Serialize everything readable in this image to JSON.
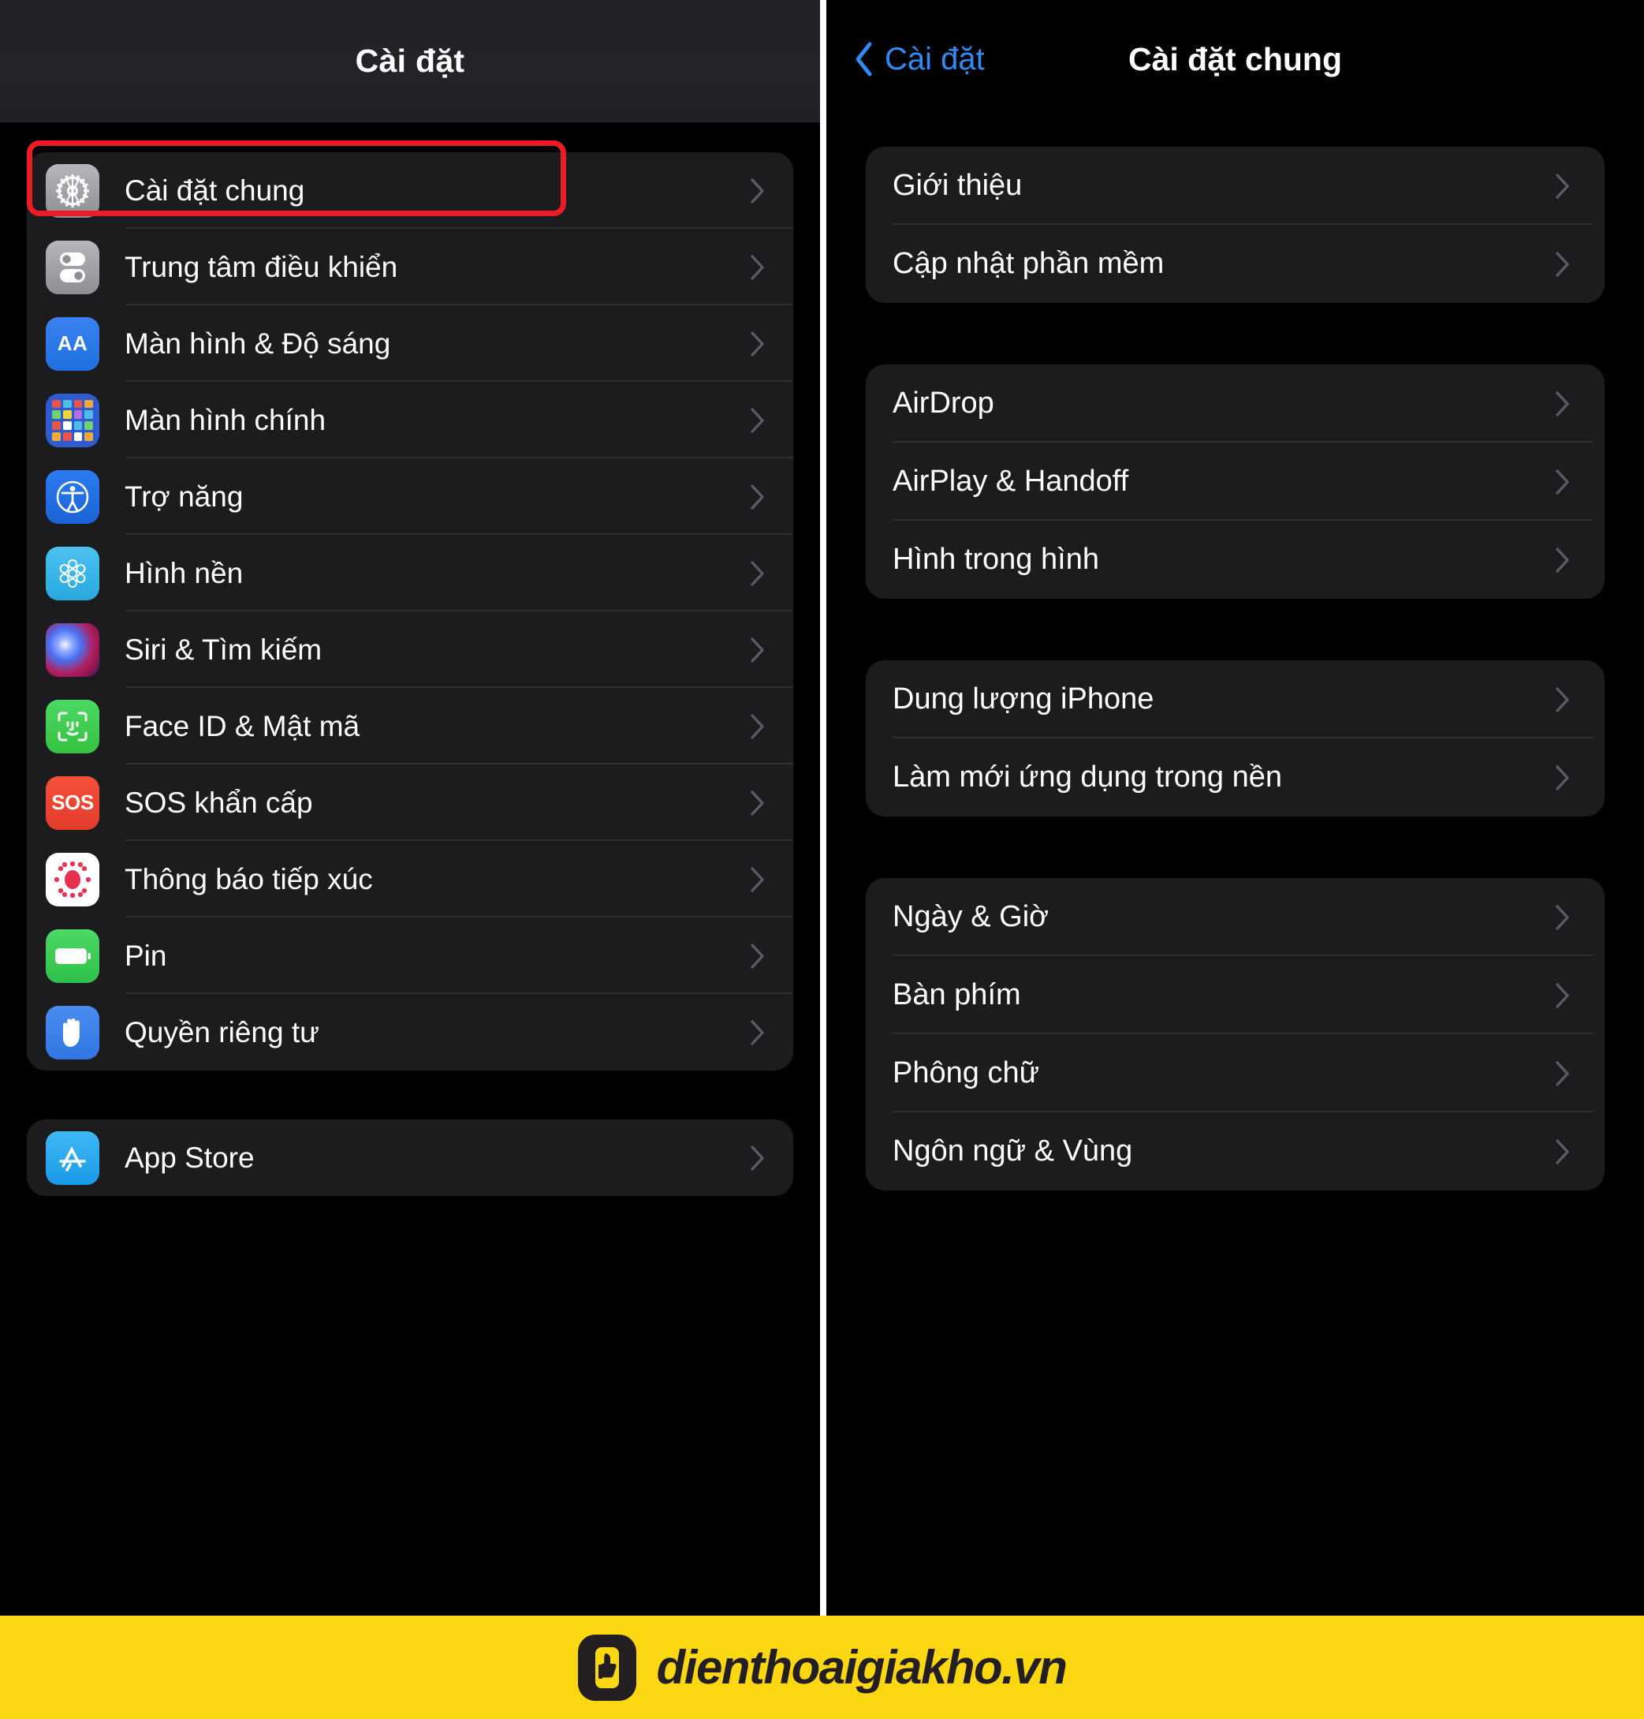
{
  "left_screen": {
    "nav": {
      "title": "Cài đặt"
    },
    "highlighted_row": "Cài đặt chung",
    "groups": [
      {
        "rows": [
          {
            "label": "Cài đặt chung",
            "icon": "gear-icon"
          },
          {
            "label": "Trung tâm điều khiển",
            "icon": "control-center-icon"
          },
          {
            "label": "Màn hình & Độ sáng",
            "icon": "display-brightness-icon"
          },
          {
            "label": "Màn hình chính",
            "icon": "home-screen-icon"
          },
          {
            "label": "Trợ năng",
            "icon": "accessibility-icon"
          },
          {
            "label": "Hình nền",
            "icon": "wallpaper-icon"
          },
          {
            "label": "Siri & Tìm kiếm",
            "icon": "siri-icon"
          },
          {
            "label": "Face ID & Mật mã",
            "icon": "face-id-icon"
          },
          {
            "label": "SOS khẩn cấp",
            "icon": "sos-icon"
          },
          {
            "label": "Thông báo tiếp xúc",
            "icon": "exposure-notification-icon"
          },
          {
            "label": "Pin",
            "icon": "battery-icon"
          },
          {
            "label": "Quyền riêng tư",
            "icon": "privacy-hand-icon"
          }
        ]
      },
      {
        "rows": [
          {
            "label": "App Store",
            "icon": "app-store-icon"
          }
        ]
      }
    ]
  },
  "right_screen": {
    "nav": {
      "back_label": "Cài đặt",
      "title": "Cài đặt chung"
    },
    "groups": [
      {
        "rows": [
          {
            "label": "Giới thiệu"
          },
          {
            "label": "Cập nhật phần mềm"
          }
        ]
      },
      {
        "rows": [
          {
            "label": "AirDrop"
          },
          {
            "label": "AirPlay & Handoff"
          },
          {
            "label": "Hình trong hình"
          }
        ]
      },
      {
        "rows": [
          {
            "label": "Dung lượng iPhone"
          },
          {
            "label": "Làm mới ứng dụng trong nền"
          }
        ]
      },
      {
        "rows": [
          {
            "label": "Ngày & Giờ"
          },
          {
            "label": "Bàn phím"
          },
          {
            "label": "Phông chữ"
          },
          {
            "label": "Ngôn ngữ & Vùng"
          }
        ]
      }
    ]
  },
  "footer": {
    "brand": "dienthoaigiakho.vn",
    "logo_icon": "phone-thumb-logo-icon",
    "background_color": "#fbd711",
    "text_color": "#231f20"
  },
  "colors": {
    "accent_blue": "#2f8cf5",
    "highlight_red": "#ed1c24",
    "card_background": "#1c1c1e",
    "screen_background": "#000000",
    "separator": "#2e2e31"
  }
}
